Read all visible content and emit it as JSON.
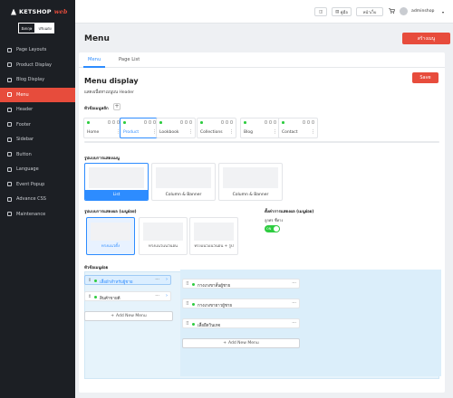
{
  "brand": {
    "name": "KETSHOP",
    "accent": "web"
  },
  "lang": {
    "th": "อังกฤษ",
    "active": "ปรับแต่ง"
  },
  "sidebar": {
    "items": [
      {
        "label": "Page Layouts",
        "icon": "layout-icon"
      },
      {
        "label": "Product Display",
        "icon": "grid-icon"
      },
      {
        "label": "Blog Display",
        "icon": "blog-icon"
      },
      {
        "label": "Menu",
        "icon": "menu-icon"
      },
      {
        "label": "Header",
        "icon": "header-icon"
      },
      {
        "label": "Footer",
        "icon": "footer-icon"
      },
      {
        "label": "Sidebar",
        "icon": "sidebar-icon"
      },
      {
        "label": "Button",
        "icon": "button-icon"
      },
      {
        "label": "Language",
        "icon": "globe-icon"
      },
      {
        "label": "Event Popup",
        "icon": "popup-icon"
      },
      {
        "label": "Advance CSS",
        "icon": "css-icon"
      },
      {
        "label": "Maintenance",
        "icon": "wrench-icon"
      }
    ]
  },
  "topbar": {
    "btn1": "◫",
    "btn2": "คู่มือ",
    "btn3": "หน้าเว็บ",
    "user": "adminshop"
  },
  "page": {
    "title": "Menu",
    "create": "สร้างเมนู"
  },
  "tabs": [
    "Menu",
    "Page List"
  ],
  "display": {
    "title": "Menu display",
    "subtitle": "แสดงเนื้อหาเมนูบน Header",
    "save": "Save"
  },
  "labels": {
    "menu_tabs": "หัวข้อเมนูหลัก",
    "style": "รูปแบบการแสดงเมนู",
    "sub_style": "รูปแบบการแสดงผล (เมนูย่อย)",
    "settings": "ตั้งค่าการแสดงผล (เมนูย่อย)",
    "toggle_label": "ลูกศร ชี้ทาง",
    "toggle_state": "ON",
    "sub_menu": "หัวข้อเมนูย่อย"
  },
  "menu_tabs": [
    "Home",
    "Product",
    "Lookbook",
    "Collections",
    "Blog",
    "Contact"
  ],
  "styles": [
    "List",
    "Column & Banner",
    "Column & Banner"
  ],
  "sub_styles": [
    "ทรงแนวตั้ง",
    "ทรงแนวแนวนอน",
    "ทรงแนวแนวนอน + รูป"
  ],
  "left_items": [
    "เสื้อผ้าสำหรับผู้ชาย",
    "สินค้าขายดี"
  ],
  "right_items": [
    "กางเกงขาสั้นผู้ชาย",
    "กางเกงขายาวผู้ชาย",
    "เสื้อยืดวินเทจ"
  ],
  "add_new": "Add New Menu"
}
